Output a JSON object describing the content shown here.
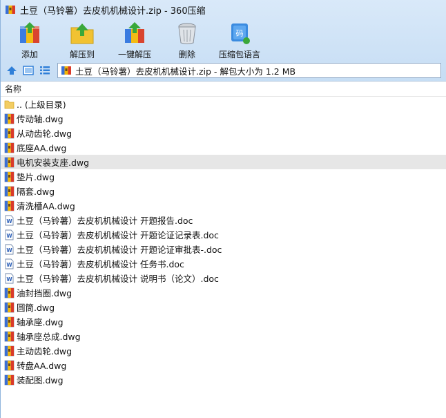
{
  "window": {
    "title": "土豆（马铃薯）去皮机机械设计.zip - 360压缩"
  },
  "toolbar": {
    "items": [
      {
        "label": "添加",
        "icon": "add-archive-icon"
      },
      {
        "label": "解压到",
        "icon": "extract-to-icon"
      },
      {
        "label": "一键解压",
        "icon": "one-click-extract-icon"
      },
      {
        "label": "删除",
        "icon": "trash-icon"
      },
      {
        "label": "压缩包语言",
        "icon": "archive-language-icon"
      }
    ]
  },
  "addressbar": {
    "text": "土豆（马铃薯）去皮机机械设计.zip - 解包大小为 1.2 MB"
  },
  "filelist": {
    "column_name": "名称",
    "rows": [
      {
        "name": ".. (上级目录)",
        "type": "folder"
      },
      {
        "name": "传动轴.dwg",
        "type": "dwg"
      },
      {
        "name": "从动齿轮.dwg",
        "type": "dwg"
      },
      {
        "name": "底座AA.dwg",
        "type": "dwg"
      },
      {
        "name": "电机安装支座.dwg",
        "type": "dwg",
        "selected": true
      },
      {
        "name": "垫片.dwg",
        "type": "dwg"
      },
      {
        "name": "隔套.dwg",
        "type": "dwg"
      },
      {
        "name": "清洗槽AA.dwg",
        "type": "dwg"
      },
      {
        "name": "土豆（马铃薯）去皮机机械设计 开题报告.doc",
        "type": "doc"
      },
      {
        "name": "土豆（马铃薯）去皮机机械设计 开题论证记录表.doc",
        "type": "doc"
      },
      {
        "name": "土豆（马铃薯）去皮机机械设计 开题论证审批表-.doc",
        "type": "doc"
      },
      {
        "name": "土豆（马铃薯）去皮机机械设计 任务书.doc",
        "type": "doc"
      },
      {
        "name": "土豆（马铃薯）去皮机机械设计 说明书（论文）.doc",
        "type": "doc"
      },
      {
        "name": "油封挡圈.dwg",
        "type": "dwg"
      },
      {
        "name": "圆筒.dwg",
        "type": "dwg"
      },
      {
        "name": "轴承座.dwg",
        "type": "dwg"
      },
      {
        "name": "轴承座总成.dwg",
        "type": "dwg"
      },
      {
        "name": "主动齿轮.dwg",
        "type": "dwg"
      },
      {
        "name": "转盘AA.dwg",
        "type": "dwg"
      },
      {
        "name": "装配图.dwg",
        "type": "dwg"
      }
    ]
  },
  "colors": {
    "selected_row": "#e6e6e6",
    "chrome": "#c6ddf4"
  }
}
